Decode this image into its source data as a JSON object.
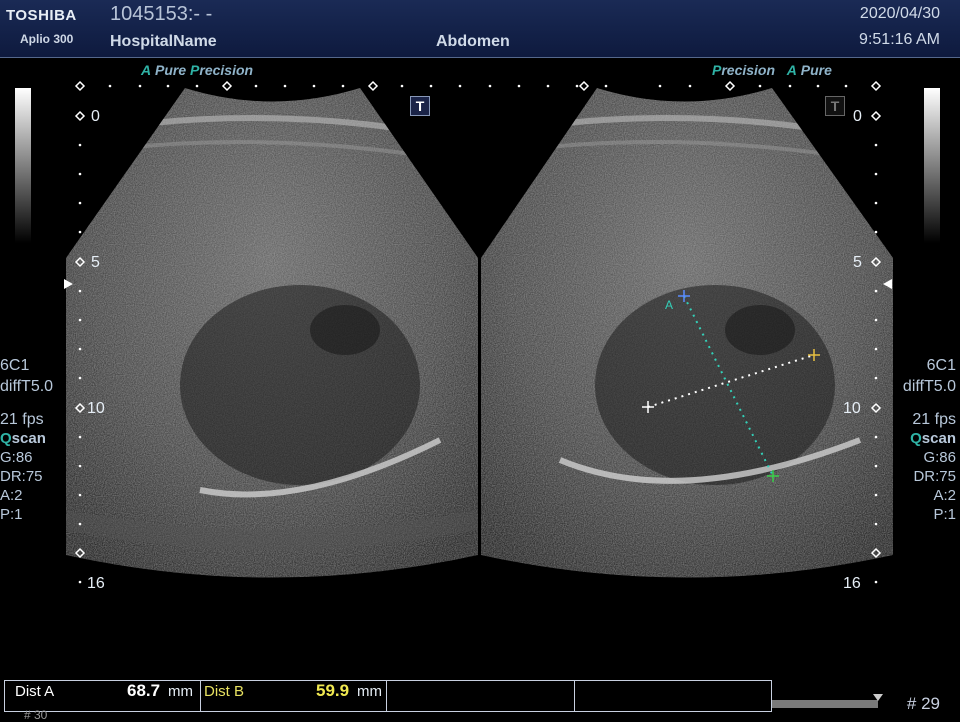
{
  "header": {
    "brand": "TOSHIBA",
    "model": "Aplio 300",
    "patient_id": "1045153:- -",
    "hospital": "HospitalName",
    "exam": "Abdomen",
    "date": "2020/04/30",
    "time": "9:51:16 AM"
  },
  "image_modes": {
    "left": {
      "a": "A",
      "pure": "Pure",
      "p": "P",
      "precision": "recision"
    },
    "right": {
      "p": "P",
      "precision": "recision",
      "a": "A",
      "pure": "Pure"
    }
  },
  "depth_scale": {
    "d0": "0",
    "d5": "5",
    "d10": "10",
    "d16": "16"
  },
  "params": {
    "probe": "6C1",
    "preset": "diffT5.0",
    "fps": "21 fps",
    "qscan_q": "Q",
    "qscan_rest": "scan",
    "gain": "G:86",
    "dr": "DR:75",
    "a": "A:2",
    "p": "P:1"
  },
  "caliper": {
    "label_a": "A"
  },
  "measurements": [
    {
      "label": "Dist A",
      "value": "68.7",
      "unit": "mm",
      "label_color": "#ffffff",
      "value_color": "#ffffff"
    },
    {
      "label": "Dist B",
      "value": "59.9",
      "unit": "mm",
      "label_color": "#e6e060",
      "value_color": "#f0e850"
    }
  ],
  "frame_number": "# 29",
  "bottom_stub": "# 30"
}
